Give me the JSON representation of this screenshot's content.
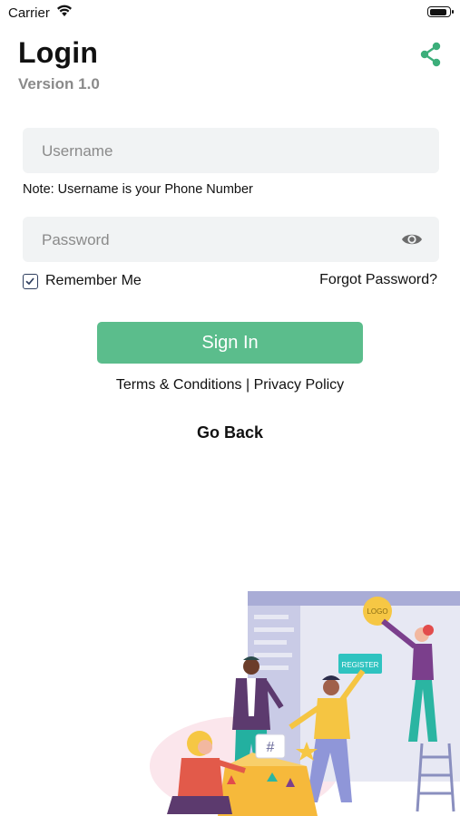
{
  "status_bar": {
    "carrier": "Carrier"
  },
  "header": {
    "title": "Login",
    "version": "Version 1.0"
  },
  "form": {
    "username": {
      "placeholder": "Username",
      "value": ""
    },
    "note": "Note: Username is your Phone Number",
    "password": {
      "placeholder": "Password",
      "value": ""
    },
    "remember_me": {
      "label": "Remember Me",
      "checked": true
    },
    "forgot_password": "Forgot Password?",
    "sign_in": "Sign In"
  },
  "links": {
    "terms": "Terms & Conditions",
    "separator": "|",
    "privacy": "Privacy Policy"
  },
  "go_back": "Go Back",
  "illustration": {
    "register_sign": "REGISTER",
    "logo_badge": "LOGO"
  },
  "colors": {
    "accent": "#5bbd8c",
    "field_bg": "#f1f3f4",
    "muted": "#8a8a8a"
  }
}
